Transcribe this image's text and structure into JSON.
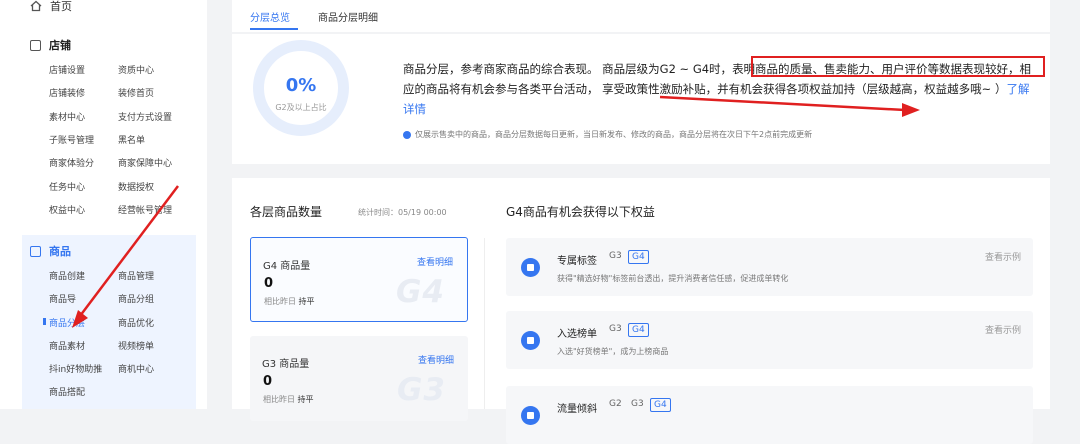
{
  "sidebar": {
    "home": "首页",
    "shop": {
      "title": "店铺",
      "items": [
        "店铺设置",
        "资质中心",
        "店铺装修",
        "装修首页",
        "素材中心",
        "支付方式设置",
        "子账号管理",
        "黑名单",
        "商家体验分",
        "商家保障中心",
        "任务中心",
        "数据授权",
        "权益中心",
        "经营帐号管理"
      ]
    },
    "product": {
      "title": "商品",
      "items": [
        "商品创建",
        "商品管理",
        "商品导",
        "商品分组",
        "商品分层",
        "商品优化",
        "商品素材",
        "视频榜单",
        "抖in好物助推",
        "商机中心",
        "商品搭配"
      ]
    }
  },
  "tabs": [
    "分层总览",
    "商品分层明细"
  ],
  "overview": {
    "percent": "0%",
    "percent_caption": "G2及以上占比",
    "description_a": "商品分层，参考商家商品的综合表现。 商品层级为G2 ~ G4时，",
    "description_b": "表明商品的质量、售卖能力、用户评价等数据表现",
    "description_c": "较好，相应的商品将有机会参与各类平台活动， 享受政策性激励补贴，并有机会获得各项权益加持（层级越高，权益越多哦~ ）",
    "learn_more": "了解详情",
    "note": "仅展示售卖中的商品，商品分层数据每日更新，当日新发布、修改的商品，商品分层将在次日下午2点前完成更新"
  },
  "counts": {
    "title": "各层商品数量",
    "time": "统计时间：05/19 00:00",
    "cards": [
      {
        "name": "G4 商品量",
        "link": "查看明细",
        "value": "0",
        "compare": "相比昨日",
        "trend": "持平",
        "watermark": "G4"
      },
      {
        "name": "G3 商品量",
        "link": "查看明细",
        "value": "0",
        "compare": "相比昨日",
        "trend": "持平",
        "watermark": "G3"
      }
    ]
  },
  "benefits": {
    "title": "G4商品有机会获得以下权益",
    "items": [
      {
        "title": "专属标签",
        "tags": [
          "G3",
          "G4"
        ],
        "desc": "获得\"精选好物\"标签前台透出，提升消费者信任感，促进成单转化",
        "example": "查看示例"
      },
      {
        "title": "入选榜单",
        "tags": [
          "G3",
          "G4"
        ],
        "desc": "入选\"好货榜单\"，成为上榜商品",
        "example": "查看示例"
      },
      {
        "title": "流量倾斜",
        "tags": [
          "G2",
          "G3",
          "G4"
        ],
        "desc": "",
        "example": ""
      }
    ]
  },
  "colors": {
    "accent": "#3576f0",
    "annotation": "#e02020"
  }
}
